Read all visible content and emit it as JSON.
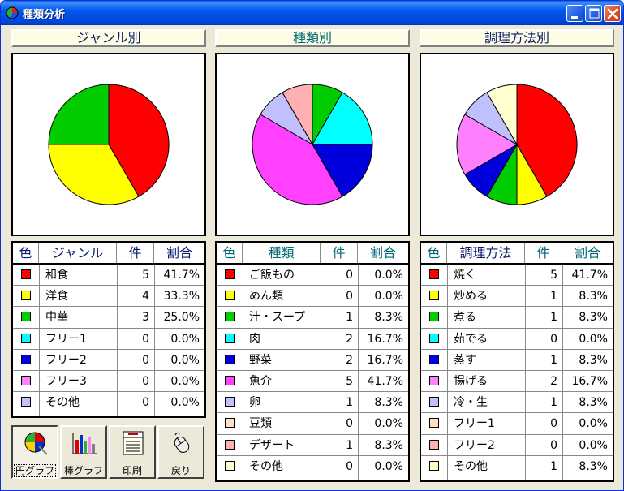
{
  "window": {
    "title": "種類分析"
  },
  "panels": [
    {
      "header": "ジャンル別",
      "columns": [
        "色",
        "ジャンル",
        "件",
        "割合"
      ],
      "rows": [
        {
          "color": "#ff0000",
          "label": "和食",
          "count": "5",
          "pct": "41.7%"
        },
        {
          "color": "#ffff00",
          "label": "洋食",
          "count": "4",
          "pct": "33.3%"
        },
        {
          "color": "#00cc00",
          "label": "中華",
          "count": "3",
          "pct": "25.0%"
        },
        {
          "color": "#00ffff",
          "label": "フリー1",
          "count": "0",
          "pct": "0.0%"
        },
        {
          "color": "#0000dd",
          "label": "フリー2",
          "count": "0",
          "pct": "0.0%"
        },
        {
          "color": "#ff80ff",
          "label": "フリー3",
          "count": "0",
          "pct": "0.0%"
        },
        {
          "color": "#c0c0ff",
          "label": "その他",
          "count": "0",
          "pct": "0.0%"
        }
      ]
    },
    {
      "header": "種類別",
      "columns": [
        "色",
        "種類",
        "件",
        "割合"
      ],
      "rows": [
        {
          "color": "#ff0000",
          "label": "ご飯もの",
          "count": "0",
          "pct": "0.0%"
        },
        {
          "color": "#ffff00",
          "label": "めん類",
          "count": "0",
          "pct": "0.0%"
        },
        {
          "color": "#00cc00",
          "label": "汁・スープ",
          "count": "1",
          "pct": "8.3%"
        },
        {
          "color": "#00ffff",
          "label": "肉",
          "count": "2",
          "pct": "16.7%"
        },
        {
          "color": "#0000dd",
          "label": "野菜",
          "count": "2",
          "pct": "16.7%"
        },
        {
          "color": "#ff40ff",
          "label": "魚介",
          "count": "5",
          "pct": "41.7%"
        },
        {
          "color": "#c0c0ff",
          "label": "卵",
          "count": "1",
          "pct": "8.3%"
        },
        {
          "color": "#ffe0c0",
          "label": "豆類",
          "count": "0",
          "pct": "0.0%"
        },
        {
          "color": "#ffb0b0",
          "label": "デザート",
          "count": "1",
          "pct": "8.3%"
        },
        {
          "color": "#ffffd0",
          "label": "その他",
          "count": "0",
          "pct": "0.0%"
        }
      ]
    },
    {
      "header": "調理方法別",
      "columns": [
        "色",
        "調理方法",
        "件",
        "割合"
      ],
      "rows": [
        {
          "color": "#ff0000",
          "label": "焼く",
          "count": "5",
          "pct": "41.7%"
        },
        {
          "color": "#ffff00",
          "label": "炒める",
          "count": "1",
          "pct": "8.3%"
        },
        {
          "color": "#00cc00",
          "label": "煮る",
          "count": "1",
          "pct": "8.3%"
        },
        {
          "color": "#00ffff",
          "label": "茹でる",
          "count": "0",
          "pct": "0.0%"
        },
        {
          "color": "#0000dd",
          "label": "蒸す",
          "count": "1",
          "pct": "8.3%"
        },
        {
          "color": "#ff80ff",
          "label": "揚げる",
          "count": "2",
          "pct": "16.7%"
        },
        {
          "color": "#c0c0ff",
          "label": "冷・生",
          "count": "1",
          "pct": "8.3%"
        },
        {
          "color": "#ffe0c0",
          "label": "フリー1",
          "count": "0",
          "pct": "0.0%"
        },
        {
          "color": "#ffb0b0",
          "label": "フリー2",
          "count": "0",
          "pct": "0.0%"
        },
        {
          "color": "#ffffd0",
          "label": "その他",
          "count": "1",
          "pct": "8.3%"
        }
      ]
    }
  ],
  "chart_data": [
    {
      "type": "pie",
      "categories": [
        "和食",
        "洋食",
        "中華",
        "フリー1",
        "フリー2",
        "フリー3",
        "その他"
      ],
      "values": [
        5,
        4,
        3,
        0,
        0,
        0,
        0
      ],
      "colors": [
        "#ff0000",
        "#ffff00",
        "#00cc00",
        "#00ffff",
        "#0000dd",
        "#ff80ff",
        "#c0c0ff"
      ]
    },
    {
      "type": "pie",
      "categories": [
        "ご飯もの",
        "めん類",
        "汁・スープ",
        "肉",
        "野菜",
        "魚介",
        "卵",
        "豆類",
        "デザート",
        "その他"
      ],
      "values": [
        0,
        0,
        1,
        2,
        2,
        5,
        1,
        0,
        1,
        0
      ],
      "colors": [
        "#ff0000",
        "#ffff00",
        "#00cc00",
        "#00ffff",
        "#0000dd",
        "#ff40ff",
        "#c0c0ff",
        "#ffe0c0",
        "#ffb0b0",
        "#ffffd0"
      ]
    },
    {
      "type": "pie",
      "categories": [
        "焼く",
        "炒める",
        "煮る",
        "茹でる",
        "蒸す",
        "揚げる",
        "冷・生",
        "フリー1",
        "フリー2",
        "その他"
      ],
      "values": [
        5,
        1,
        1,
        0,
        1,
        2,
        1,
        0,
        0,
        1
      ],
      "colors": [
        "#ff0000",
        "#ffff00",
        "#00cc00",
        "#00ffff",
        "#0000dd",
        "#ff80ff",
        "#c0c0ff",
        "#ffe0c0",
        "#ffb0b0",
        "#ffffd0"
      ]
    }
  ],
  "toolbar": {
    "buttons": [
      {
        "label": "円グラフ",
        "icon": "pie-chart-icon",
        "pressed": true
      },
      {
        "label": "棒グラフ",
        "icon": "bar-chart-icon",
        "pressed": false
      },
      {
        "label": "印刷",
        "icon": "print-note-icon",
        "pressed": false
      },
      {
        "label": "戻り",
        "icon": "mouse-icon",
        "pressed": false
      }
    ]
  }
}
